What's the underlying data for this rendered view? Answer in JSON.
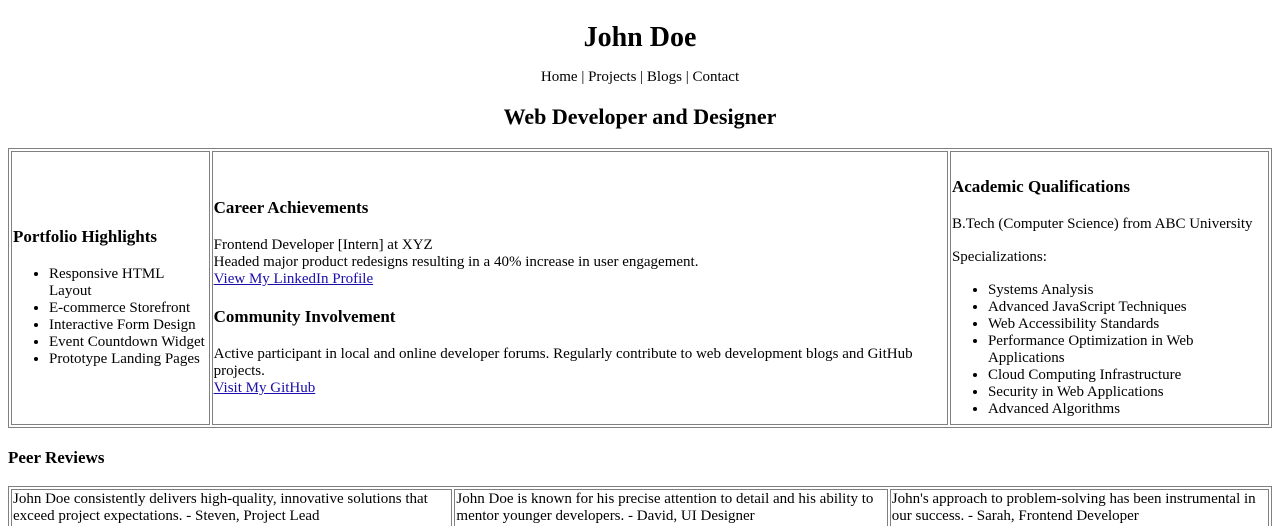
{
  "header": {
    "name": "John Doe",
    "nav": [
      "Home",
      "Projects",
      "Blogs",
      "Contact"
    ],
    "separator": "|",
    "subtitle": "Web Developer and Designer"
  },
  "portfolio": {
    "title": "Portfolio Highlights",
    "items": [
      "Responsive HTML Layout",
      "E-commerce Storefront",
      "Interactive Form Design",
      "Event Countdown Widget",
      "Prototype Landing Pages"
    ]
  },
  "career": {
    "title": "Career Achievements",
    "role": "Frontend Developer [Intern] at XYZ",
    "description": "Headed major product redesigns resulting in a 40% increase in user engagement.",
    "link": "View My LinkedIn Profile"
  },
  "community": {
    "title": "Community Involvement",
    "description": "Active participant in local and online developer forums. Regularly contribute to web development blogs and GitHub projects.",
    "link": "Visit My GitHub"
  },
  "academic": {
    "title": "Academic Qualifications",
    "degree": "B.Tech (Computer Science) from ABC University",
    "spec_label": "Specializations:",
    "items": [
      "Systems Analysis",
      "Advanced JavaScript Techniques",
      "Web Accessibility Standards",
      "Performance Optimization in Web Applications",
      "Cloud Computing Infrastructure",
      "Security in Web Applications",
      "Advanced Algorithms"
    ]
  },
  "reviews": {
    "title": "Peer Reviews",
    "items": [
      "John Doe consistently delivers high-quality, innovative solutions that exceed project expectations. - Steven, Project Lead",
      "John Doe is known for his precise attention to detail and his ability to mentor younger developers. - David, UI Designer",
      "John's approach to problem-solving has been instrumental in our success. - Sarah, Frontend Developer"
    ]
  }
}
